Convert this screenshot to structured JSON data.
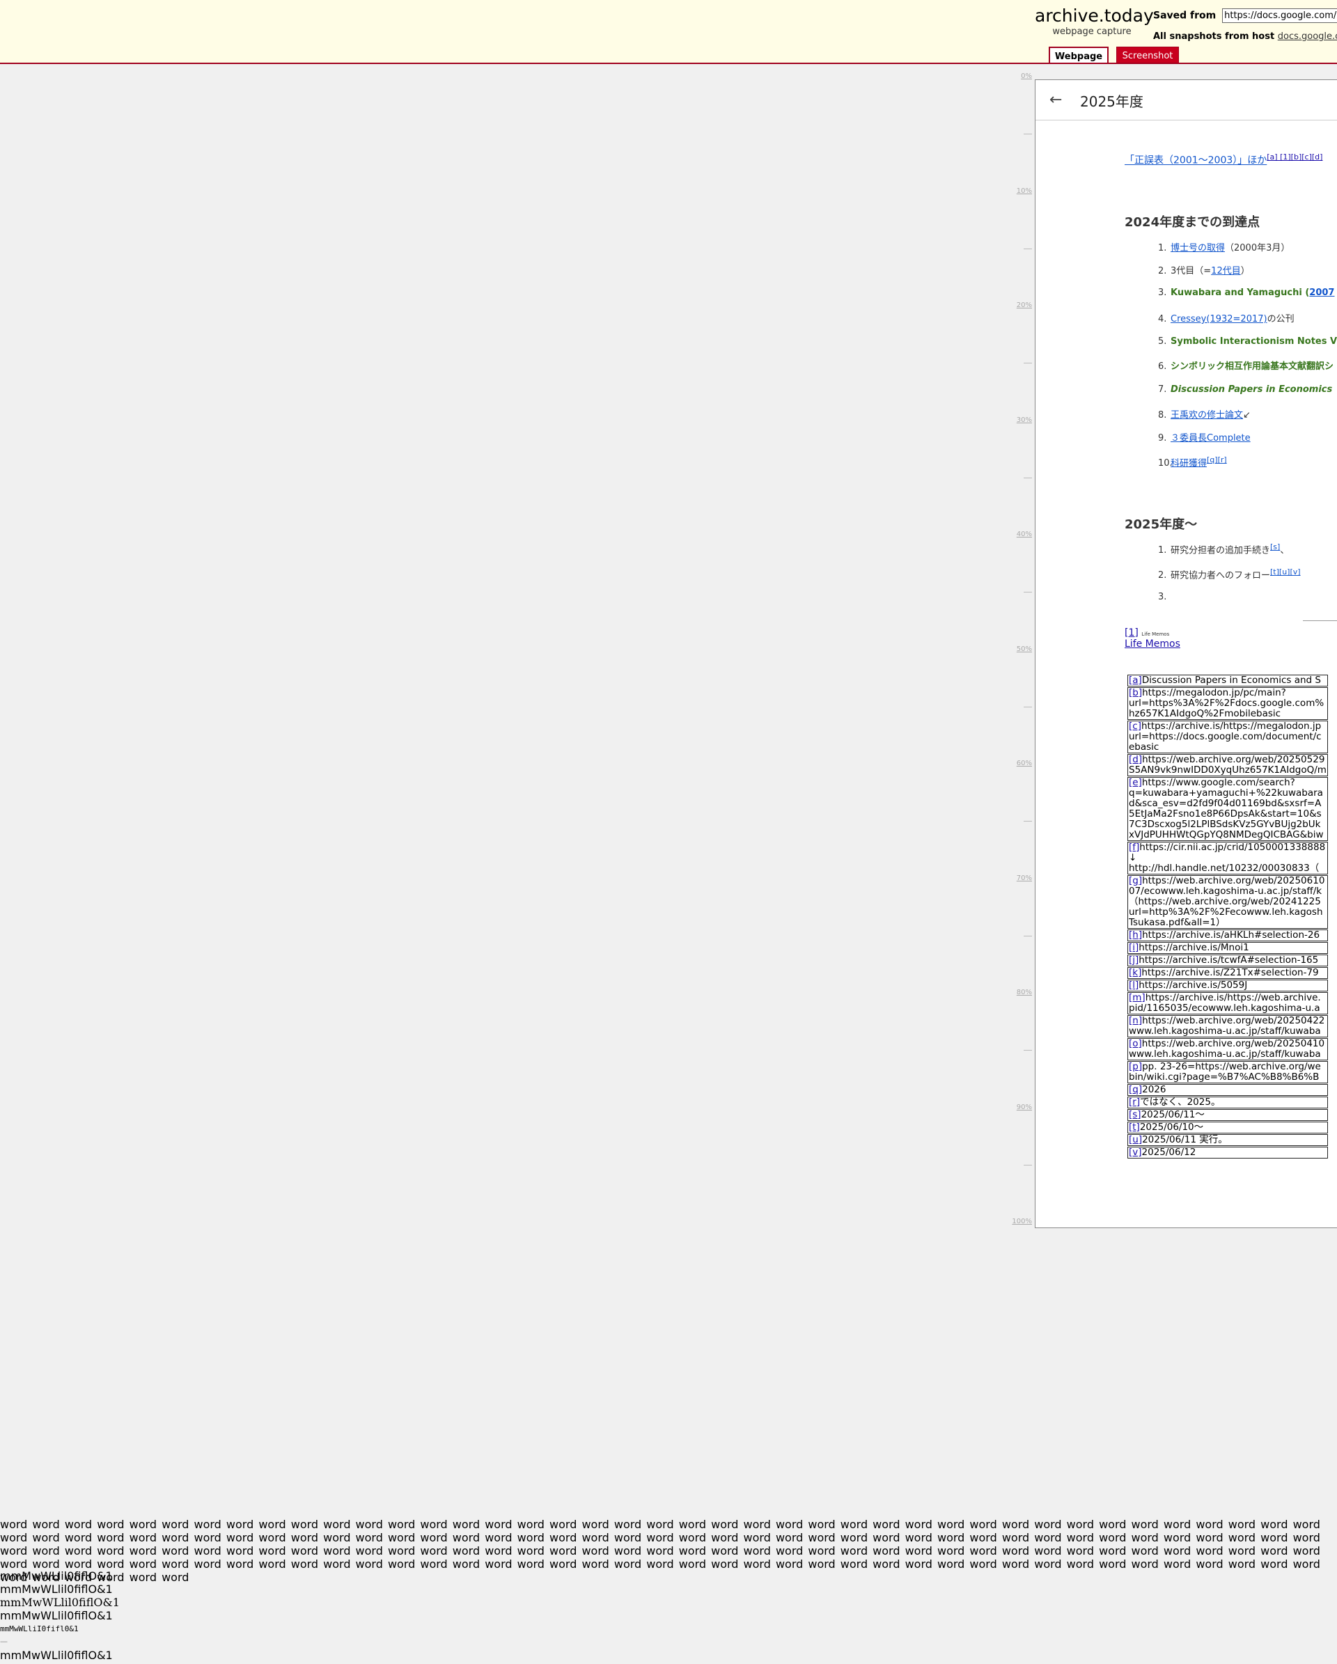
{
  "header": {
    "brand_title": "archive.today",
    "brand_subtitle": "webpage capture",
    "saved_from_label": "Saved from",
    "saved_from_url": "https://docs.google.com/",
    "all_snapshots_label": "All snapshots",
    "from_host_label": "from host",
    "host_link": "docs.google.com",
    "tab_webpage": "Webpage",
    "tab_screenshot": "Screenshot"
  },
  "ruler": [
    "0%",
    "10%",
    "20%",
    "30%",
    "40%",
    "50%",
    "60%",
    "70%",
    "80%",
    "90%",
    "100%"
  ],
  "document": {
    "back_icon": "arrow-left-icon",
    "title": "2025年度",
    "intro_link": "「正誤表（2001〜2003）」ほか",
    "intro_sup": "[a] [1][b][c][d]",
    "section1_title": "2024年度までの到達点",
    "section1_items": [
      {
        "num": "1.",
        "link": "博士号の取得",
        "text": "（2000年3月）"
      },
      {
        "num": "2.",
        "text": "3代目（=",
        "link": "12代目",
        "text2": "）"
      },
      {
        "num": "3.",
        "text": "Kuwabara and Yamaguchi (",
        "link": "2007"
      },
      {
        "num": "4.",
        "link": "Cressey(1932=2017)",
        "text": "の公刊"
      },
      {
        "num": "5.",
        "text": "Symbolic Interactionism Notes V"
      },
      {
        "num": "6.",
        "text": "シンボリック相互作用論基本文献翻訳シ"
      },
      {
        "num": "7.",
        "text": "Discussion Papers in Economics"
      },
      {
        "num": "8.",
        "link": "王禹欢の修士論文",
        "text": "↙"
      },
      {
        "num": "9.",
        "link": "３委員長Complete"
      },
      {
        "num": "10.",
        "link": "科研獲得",
        "sup": "[q][r]"
      }
    ],
    "section2_title": "2025年度〜",
    "section2_items": [
      {
        "num": "1.",
        "text": "研究分担者の追加手続き",
        "sup": "[s]",
        "text2": "、"
      },
      {
        "num": "2.",
        "text": "研究協力者へのフォロー",
        "sup": "[t][u][v]"
      },
      {
        "num": "3.",
        "text": ""
      }
    ],
    "footnote1_ref": "[1]",
    "footnote1_tiny": "Life Memos",
    "footnote1_link": "Life Memos",
    "footnotes": [
      {
        "id": "[a]",
        "lines": [
          "Discussion Papers in Economics and S"
        ]
      },
      {
        "id": "[b]",
        "lines": [
          "https://megalodon.jp/pc/main?",
          "url=https%3A%2F%2Fdocs.google.com%",
          "hz657K1AIdgoQ%2Fmobilebasic"
        ]
      },
      {
        "id": "[c]",
        "lines": [
          "https://archive.is/https://megalodon.jp",
          "url=https://docs.google.com/document/c",
          "ebasic"
        ]
      },
      {
        "id": "[d]",
        "lines": [
          "https://web.archive.org/web/20250529",
          "S5AN9vk9nwIDD0XyqUhz657K1AIdgoQ/m"
        ]
      },
      {
        "id": "[e]",
        "lines": [
          "https://www.google.com/search?",
          "q=kuwabara+yamaguchi+%22kuwabara",
          "d&sca_esv=d2fd9f04d01169bd&sxsrf=A",
          "5EtJaMa2Fsno1e8P66DpsAk&start=10&s",
          "7C3Dscxog5l2LPlBSdsKVz5GYvBUjg2bUk",
          "xVJdPUHHWtQGpYQ8NMDegQICBAG&biw"
        ]
      },
      {
        "id": "[f]",
        "lines": [
          "https://cir.nii.ac.jp/crid/1050001338888",
          "↓",
          "http://hdl.handle.net/10232/00030833（"
        ]
      },
      {
        "id": "[g]",
        "lines": [
          "https://web.archive.org/web/20250610",
          "07/ecowww.leh.kagoshima-u.ac.jp/staff/k",
          "（https://web.archive.org/web/20241225",
          "url=http%3A%2F%2Fecowww.leh.kagosh",
          "Tsukasa.pdf&all=1）"
        ]
      },
      {
        "id": "[h]",
        "lines": [
          "https://archive.is/aHKLh#selection-26"
        ]
      },
      {
        "id": "[i]",
        "lines": [
          "https://archive.is/Mnoi1"
        ]
      },
      {
        "id": "[j]",
        "lines": [
          "https://archive.is/tcwfA#selection-165"
        ]
      },
      {
        "id": "[k]",
        "lines": [
          "https://archive.is/Z21Tx#selection-79"
        ]
      },
      {
        "id": "[l]",
        "lines": [
          "https://archive.is/5059J"
        ]
      },
      {
        "id": "[m]",
        "lines": [
          "https://archive.is/https://web.archive.",
          "pid/1165035/ecowww.leh.kagoshima-u.a"
        ]
      },
      {
        "id": "[n]",
        "lines": [
          "https://web.archive.org/web/20250422",
          "www.leh.kagoshima-u.ac.jp/staff/kuwaba"
        ]
      },
      {
        "id": "[o]",
        "lines": [
          "https://web.archive.org/web/20250410",
          "www.leh.kagoshima-u.ac.jp/staff/kuwaba"
        ]
      },
      {
        "id": "[p]",
        "lines": [
          "pp. 23-26=https://web.archive.org/we",
          "bin/wiki.cgi?page=%B7%AC%B8%B6%B"
        ]
      },
      {
        "id": "[q]",
        "lines": [
          "2026"
        ]
      },
      {
        "id": "[r]",
        "lines": [
          "ではなく、2025。"
        ]
      },
      {
        "id": "[s]",
        "lines": [
          "2025/06/11〜"
        ]
      },
      {
        "id": "[t]",
        "lines": [
          "2025/06/10〜"
        ]
      },
      {
        "id": "[u]",
        "lines": [
          "2025/06/11 実行。"
        ]
      },
      {
        "id": "[v]",
        "lines": [
          "2025/06/12"
        ]
      }
    ]
  },
  "bottom": {
    "word": "word",
    "word_count": 170,
    "mm_lines": [
      "mmMwWLlil0fiflO&1",
      "mmMwWLlil0fiflO&1",
      "mmMwWLlil0fiflO&1",
      "mmMwWLlil0fiflO&1",
      "mmMwWLliI0fifl0&1",
      "—",
      "mmMwWLlil0fiflO&1"
    ]
  }
}
